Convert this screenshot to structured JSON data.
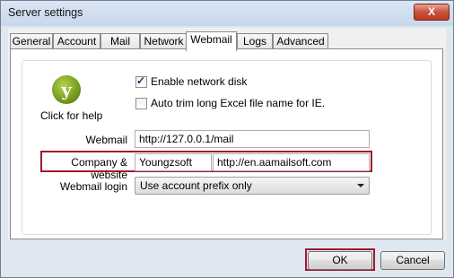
{
  "window": {
    "title": "Server settings",
    "close_symbol": "X"
  },
  "tabs": [
    "General",
    "Account",
    "Mail",
    "Network",
    "Webmail",
    "Logs",
    "Advanced"
  ],
  "active_tab": "Webmail",
  "help": {
    "icon_glyph": "y",
    "label": "Click for help"
  },
  "checkboxes": {
    "enable_network_disk": {
      "label": "Enable network disk",
      "checked": true
    },
    "auto_trim": {
      "label": "Auto trim long Excel file name for IE.",
      "checked": false
    }
  },
  "webmail": {
    "label": "Webmail",
    "value": "http://127.0.0.1/mail"
  },
  "company": {
    "label": "Company & website",
    "name": "Youngzsoft",
    "website": "http://en.aamailsoft.com"
  },
  "webmail_login": {
    "label": "Webmail login",
    "selected": "Use account prefix only"
  },
  "buttons": {
    "ok": "OK",
    "cancel": "Cancel"
  },
  "colors": {
    "highlight": "#a3182c",
    "close_button": "#c8523b",
    "frame": "#dfe7f0"
  }
}
